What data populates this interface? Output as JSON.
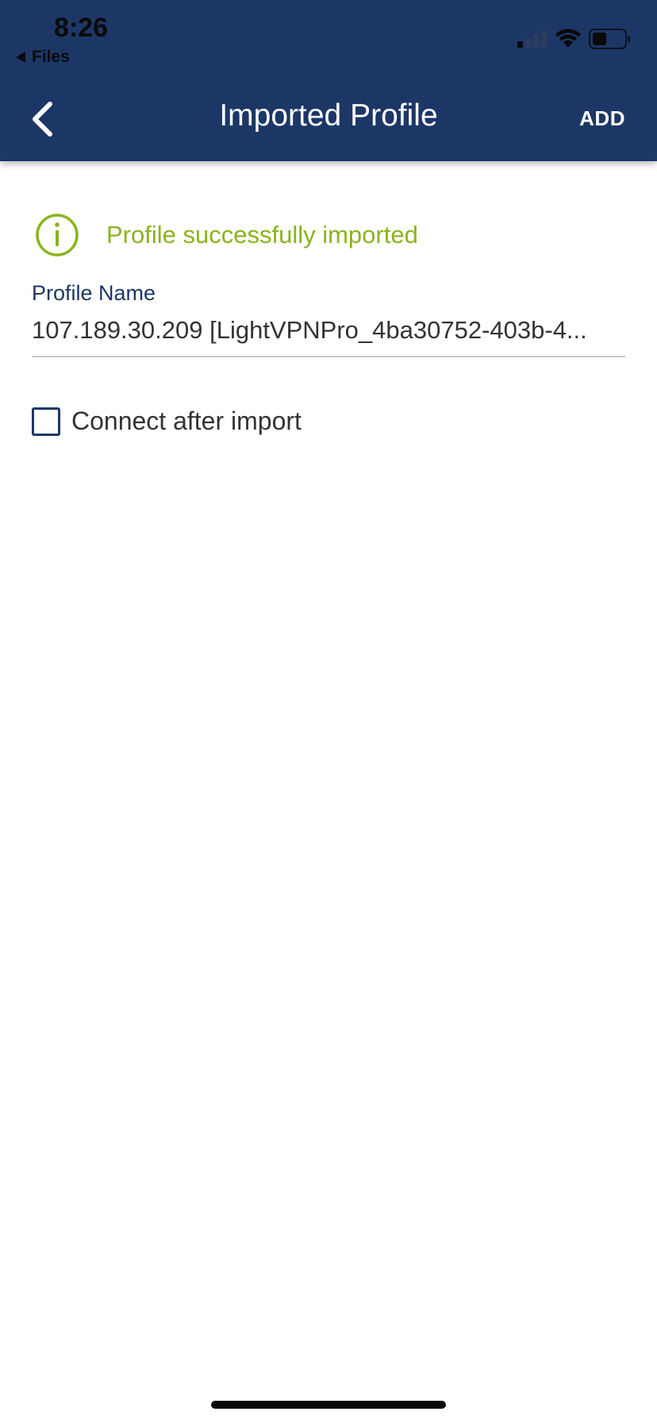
{
  "status_bar": {
    "time": "8:26",
    "back_app": "Files",
    "signal_icon": "cellular-signal-icon",
    "wifi_icon": "wifi-icon",
    "battery_icon": "battery-icon",
    "battery_level": 0.45
  },
  "nav": {
    "back_icon": "chevron-left-icon",
    "title": "Imported Profile",
    "add_label": "ADD"
  },
  "notice": {
    "icon": "info-icon",
    "text": "Profile successfully imported"
  },
  "profile_name": {
    "label": "Profile Name",
    "value": "107.189.30.209 [LightVPNPro_4ba30752-403b-4..."
  },
  "connect_option": {
    "label": "Connect after import",
    "checked": false
  },
  "colors": {
    "header_bg": "#1c3766",
    "accent_green": "#8ab31c",
    "label_blue": "#1c3766"
  }
}
